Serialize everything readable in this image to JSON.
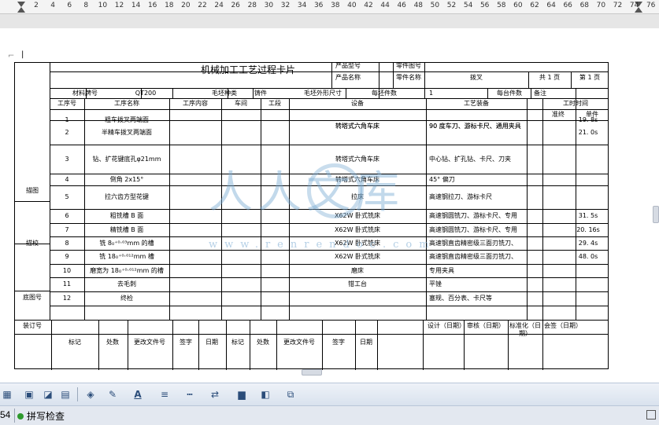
{
  "ruler": {
    "ticks": [
      "2",
      "4",
      "6",
      "8",
      "10",
      "12",
      "14",
      "16",
      "18",
      "20",
      "22",
      "24",
      "26",
      "28",
      "30",
      "32",
      "34",
      "36",
      "38",
      "40",
      "42",
      "44",
      "46",
      "48",
      "50",
      "52",
      "54",
      "56",
      "58",
      "60",
      "62",
      "64",
      "66",
      "68",
      "70",
      "72",
      "74",
      "76"
    ]
  },
  "card": {
    "title": "机械加工工艺过程卡片",
    "product_model_label": "产品型号",
    "part_drawing_label": "零件图号",
    "product_name_label": "产品名称",
    "part_name_label": "零件名称",
    "part_name_value": "拨叉",
    "total_pages": "共 1 页",
    "page_no": "第 1 页",
    "material_label": "材料牌号",
    "material_value": "QT200",
    "blank_type_label": "毛坯种类",
    "blank_type_value": "铸件",
    "blank_size_label": "毛坯外形尺寸",
    "per_blank_label": "每坯件数",
    "per_blank_value": "1",
    "per_unit_label": "每台件数",
    "remark_label": "备注",
    "headers": {
      "op_no": "工序号",
      "op_name": "工序名称",
      "content": "工序内容",
      "workshop": "车间",
      "section": "工段",
      "equipment": "设备",
      "tooling": "工艺装备",
      "time": "工时时间",
      "prep": "准终",
      "unit": "单件"
    },
    "side_labels": {
      "trace": "描图",
      "check": "描校",
      "base_no": "底图号",
      "binding_no": "装订号"
    },
    "rows": [
      {
        "no": "1",
        "name": "粗车拨叉两端面",
        "equipment": "转塔式六角车床",
        "tooling": "90 度车刀、游标卡尺、通用夹具",
        "unit": "19. 8s"
      },
      {
        "no": "2",
        "name": "半精车拨叉两端面",
        "equipment": "转塔式六角车床",
        "tooling": "90 度车刀、游标卡尺、通用夹具",
        "unit": "21. 0s"
      },
      {
        "no": "3",
        "name": "钻、扩花键底孔φ21mm",
        "equipment": "转塔式六角车床",
        "tooling": "中心钻、扩孔钻、卡尺、刀夹",
        "unit": ""
      },
      {
        "no": "4",
        "name": "倒角 2x15°",
        "equipment": "转塔式六角车床",
        "tooling": "45° 偏刀",
        "unit": ""
      },
      {
        "no": "5",
        "name": "拉六齿方型花键",
        "equipment": "拉床",
        "tooling": "高速钢拉刀、游标卡尺",
        "unit": ""
      },
      {
        "no": "6",
        "name": "粗铣槽 B 面",
        "equipment": "X62W 卧式铣床",
        "tooling": "高速钢圆铣刀、游标卡尺、专用",
        "unit": "31. 5s"
      },
      {
        "no": "7",
        "name": "精铣槽 B 面",
        "equipment": "X62W 卧式铣床",
        "tooling": "高速钢圆铣刀、游标卡尺、专用",
        "unit": "20. 16s"
      },
      {
        "no": "8",
        "name": "铣 8₀⁺⁰·⁰³mm 的槽",
        "equipment": "X62W 卧式铣床",
        "tooling": "高速钢直齿精密级三面刃铣刀、",
        "unit": "29. 4s"
      },
      {
        "no": "9",
        "name": "铣 18₀⁺⁰·⁰¹²mm 槽",
        "equipment": "X62W 卧式铣床",
        "tooling": "高速钢直齿精密级三面刃铣刀、",
        "unit": "48. 0s"
      },
      {
        "no": "10",
        "name": "磨宽为 18₀⁺⁰·⁰¹²mm 的槽",
        "equipment": "磨床",
        "tooling": "专用夹具",
        "unit": ""
      },
      {
        "no": "11",
        "name": "去毛刺",
        "equipment": "钳工台",
        "tooling": "平锉",
        "unit": ""
      },
      {
        "no": "12",
        "name": "终检",
        "equipment": "",
        "tooling": "塞规、百分表、卡尺等",
        "unit": ""
      }
    ],
    "signoff": {
      "design": "设计（日期）",
      "review": "审核（日期）",
      "standard": "标准化（日期）",
      "countersign": "会签（日期）"
    },
    "change_cols": [
      "标记",
      "处数",
      "更改文件号",
      "签字",
      "日期",
      "标记",
      "处数",
      "更改文件号",
      "签字",
      "日期"
    ]
  },
  "watermark": {
    "text": "人人文库",
    "url": "www.renrendoc.com"
  },
  "status": {
    "page_num": "54",
    "spellcheck": "拼写检查"
  }
}
